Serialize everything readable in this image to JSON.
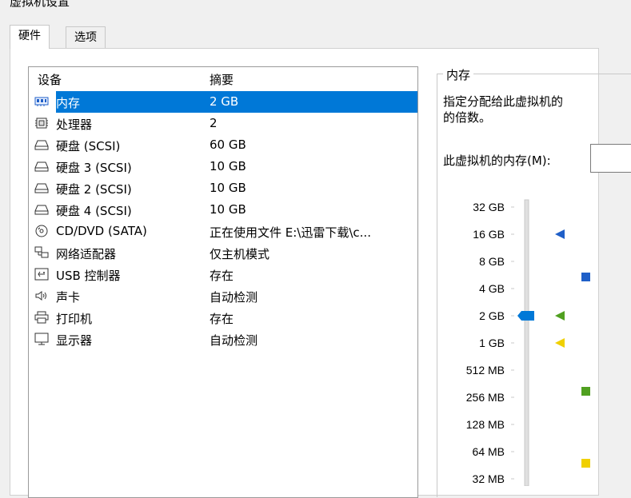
{
  "window": {
    "title": "虚拟机设置"
  },
  "tabs": [
    {
      "label": "硬件",
      "active": true
    },
    {
      "label": "选项",
      "active": false
    }
  ],
  "device_list": {
    "headers": {
      "device": "设备",
      "summary": "摘要"
    },
    "rows": [
      {
        "icon": "memory-icon",
        "label": "内存",
        "summary": "2 GB",
        "selected": true
      },
      {
        "icon": "processor-icon",
        "label": "处理器",
        "summary": "2"
      },
      {
        "icon": "hard-disk-icon",
        "label": "硬盘 (SCSI)",
        "summary": "60 GB"
      },
      {
        "icon": "hard-disk-icon",
        "label": "硬盘 3 (SCSI)",
        "summary": "10 GB"
      },
      {
        "icon": "hard-disk-icon",
        "label": "硬盘 2 (SCSI)",
        "summary": "10 GB"
      },
      {
        "icon": "hard-disk-icon",
        "label": "硬盘 4 (SCSI)",
        "summary": "10 GB"
      },
      {
        "icon": "cd-dvd-icon",
        "label": "CD/DVD (SATA)",
        "summary": "正在使用文件 E:\\迅雷下载\\c..."
      },
      {
        "icon": "network-adapter-icon",
        "label": "网络适配器",
        "summary": "仅主机模式"
      },
      {
        "icon": "usb-icon",
        "label": "USB 控制器",
        "summary": "存在"
      },
      {
        "icon": "sound-card-icon",
        "label": "声卡",
        "summary": "自动检测"
      },
      {
        "icon": "printer-icon",
        "label": "打印机",
        "summary": "存在"
      },
      {
        "icon": "display-icon",
        "label": "显示器",
        "summary": "自动检测"
      }
    ]
  },
  "memory_panel": {
    "group_title": "内存",
    "description_line1": "指定分配给此虚拟机的",
    "description_line2": "的倍数。",
    "memory_label": "此虚拟机的内存(M):",
    "memory_value": "",
    "scale_labels": [
      "32 GB",
      "16 GB",
      "8 GB",
      "4 GB",
      "2 GB",
      "1 GB",
      "512 MB",
      "256 MB",
      "128 MB",
      "64 MB",
      "32 MB"
    ],
    "slider_value_label": "2 GB",
    "colors": {
      "max_recommended": "#1f5fc8",
      "recommended": "#50a020",
      "guest_os_min": "#f0d000",
      "selection": "#0078d7"
    }
  }
}
